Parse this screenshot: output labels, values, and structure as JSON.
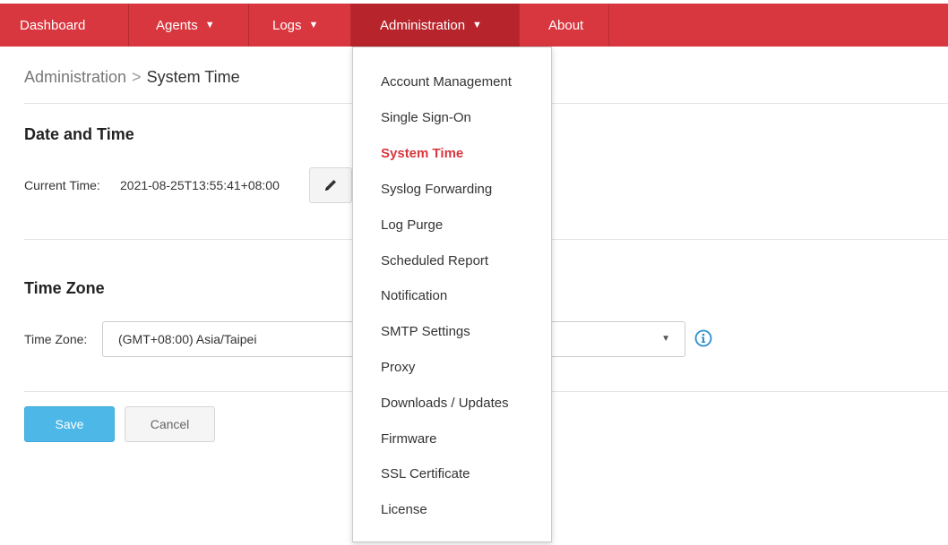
{
  "nav": {
    "items": [
      {
        "label": "Dashboard",
        "has_caret": false
      },
      {
        "label": "Agents",
        "has_caret": true
      },
      {
        "label": "Logs",
        "has_caret": true
      },
      {
        "label": "Administration",
        "has_caret": true
      },
      {
        "label": "About",
        "has_caret": false
      }
    ],
    "caret": "▼",
    "active": "Administration"
  },
  "breadcrumb": {
    "parent": "Administration",
    "separator": ">",
    "current": "System Time"
  },
  "date_time": {
    "title": "Date and Time",
    "current_label": "Current Time:",
    "current_value": "2021-08-25T13:55:41+08:00",
    "edit_icon": "pencil-icon"
  },
  "time_zone": {
    "title": "Time Zone",
    "label": "Time Zone:",
    "selected": "(GMT+08:00) Asia/Taipei",
    "caret": "▼",
    "info_icon": "info-circle-icon"
  },
  "actions": {
    "save_label": "Save",
    "cancel_label": "Cancel"
  },
  "admin_menu": {
    "items": [
      "Account Management",
      "Single Sign-On",
      "System Time",
      "Syslog Forwarding",
      "Log Purge",
      "Scheduled Report",
      "Notification",
      "SMTP Settings",
      "Proxy",
      "Downloads / Updates",
      "Firmware",
      "SSL Certificate",
      "License"
    ],
    "active": "System Time"
  },
  "colors": {
    "brand_red": "#d9373f",
    "active_nav": "#b8242b",
    "primary_button": "#4db8e8",
    "info_icon": "#2a8fd0"
  }
}
